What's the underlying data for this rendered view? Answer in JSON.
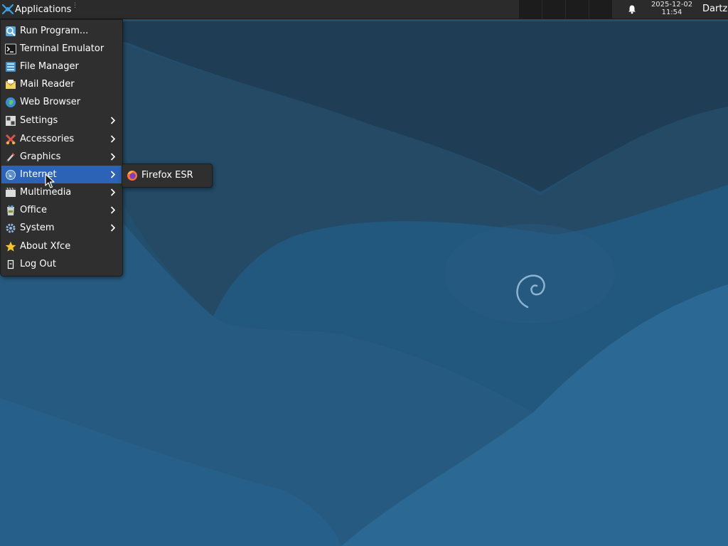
{
  "panel": {
    "applications_label": "Applications",
    "clock_date": "2025-12-02",
    "clock_time": "11:54",
    "username": "Dartz"
  },
  "menu": {
    "items": [
      {
        "label": "Run Program...",
        "icon": "run-program-icon",
        "submenu": false
      },
      {
        "label": "Terminal Emulator",
        "icon": "terminal-icon",
        "submenu": false
      },
      {
        "label": "File Manager",
        "icon": "file-manager-icon",
        "submenu": false
      },
      {
        "label": "Mail Reader",
        "icon": "mail-icon",
        "submenu": false
      },
      {
        "label": "Web Browser",
        "icon": "web-browser-icon",
        "submenu": false
      },
      {
        "label": "Settings",
        "icon": "settings-icon",
        "submenu": true
      },
      {
        "label": "Accessories",
        "icon": "accessories-icon",
        "submenu": true
      },
      {
        "label": "Graphics",
        "icon": "graphics-icon",
        "submenu": true
      },
      {
        "label": "Internet",
        "icon": "internet-icon",
        "submenu": true,
        "active": true
      },
      {
        "label": "Multimedia",
        "icon": "multimedia-icon",
        "submenu": true
      },
      {
        "label": "Office",
        "icon": "office-icon",
        "submenu": true
      },
      {
        "label": "System",
        "icon": "system-icon",
        "submenu": true
      },
      {
        "label": "About Xfce",
        "icon": "star-icon",
        "submenu": false
      },
      {
        "label": "Log Out",
        "icon": "logout-icon",
        "submenu": false
      }
    ]
  },
  "internet_submenu": {
    "items": [
      {
        "label": "Firefox ESR",
        "icon": "firefox-icon"
      }
    ]
  },
  "colors": {
    "panel_bg": "#2b2b2b",
    "menu_bg": "#2f2f2f",
    "highlight": "#2c63b6",
    "wallpaper_dark": "#1f4d6e",
    "wallpaper_light": "#2a6a96"
  }
}
